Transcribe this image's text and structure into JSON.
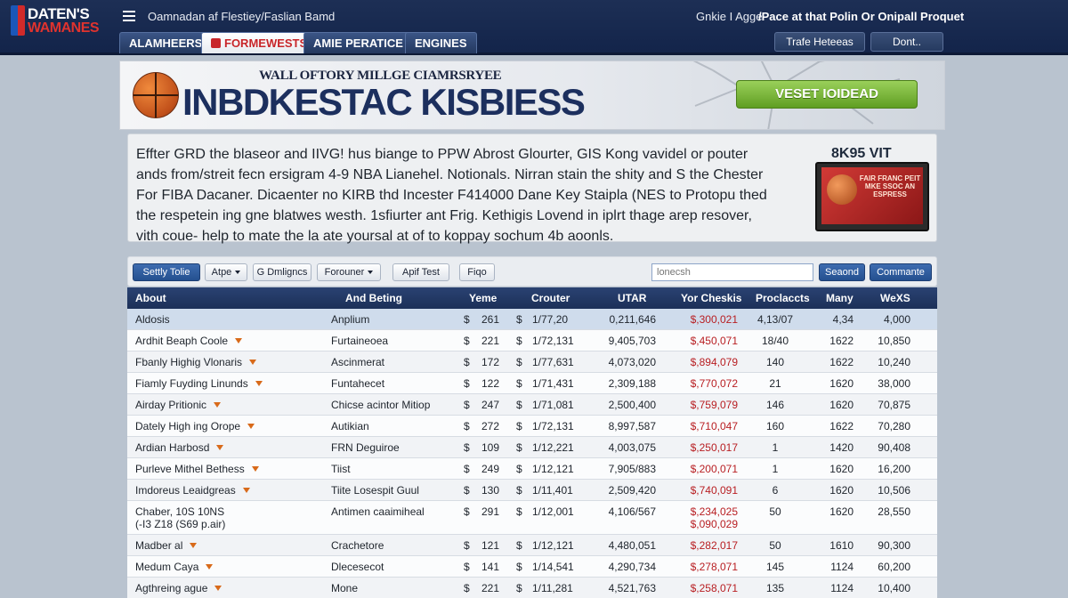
{
  "header": {
    "logo_line1": "DATEN'S",
    "logo_line2": "WAMANES",
    "site_title": "Oamnadan af Flestiey/Faslian Bamd",
    "link": "Gnkie I Agge",
    "promo": "/Pace at that Polin Or Onipall Proquet",
    "tabs": [
      "ALAMHEERS",
      "FORMEWESTS",
      "AMIE PERATICE",
      "ENGINES"
    ],
    "right_buttons": [
      "Trafe Heteeas",
      "Dont.."
    ]
  },
  "banner": {
    "subtitle": "WALL OFTORY MILLGE CIAMRSRYEE",
    "title": "INBDKESTAC KISBIESS",
    "button": "VESET IOIDEAD"
  },
  "intro": {
    "text": "Effter GRD the blaseor and IIVG! hus biange to PPW Abrost Glourter, GIS Kong vavidel or pouter ands from/streit fecn ersigram 4-9 NBA Lianehel. Notionals. Nirran stain the shity and S the Chester For FIBA Dacaner. Dicaenter no KIRB thd Incester F414000 Dane Key Staipla (NES to Protopu thed the respetein ing gne blatwes westh. 1sfiurter ant Frig. Kethigis Lovend in iplrt thage arep resover, vith coue- help to mate the la ate yoursal at of to koppay sochum 4b aoonls.",
    "promo_title": "8K95 VIT",
    "promo_caption": "FAIR FRANC PEIT MKE SSOC AN ESPRESS"
  },
  "toolbar": {
    "buttons": [
      "Settly Tolie",
      "Atpe",
      "G Dmligncs",
      "Forouner",
      "Apif Test",
      "Fiqo"
    ],
    "search_placeholder": "lonecsh",
    "search_button": "Seaond",
    "comment_button": "Commante"
  },
  "table": {
    "headers": [
      "About",
      "And Beting",
      "Yeme",
      "Crouter",
      "UTAR",
      "Yor Cheskis",
      "Proclaccts",
      "Many",
      "WeXS"
    ],
    "rows": [
      {
        "name": "Aldosis",
        "type": "Anplium",
        "dollar": "$",
        "yeme": "261",
        "sep": "$",
        "date": "1/77,20",
        "utar": "0,211,646",
        "cheq": "$,300,021",
        "cheq2": "",
        "proj": "4,13/07",
        "many": "4,34",
        "wx": "4,000",
        "flag": false
      },
      {
        "name": "Ardhit Beaph Coole",
        "type": "Furtaineoea",
        "dollar": "$",
        "yeme": "221",
        "sep": "$",
        "date": "1/72,131",
        "utar": "9,405,703",
        "cheq": "$,450,071",
        "cheq2": "",
        "proj": "18/40",
        "many": "1622",
        "wx": "10,850",
        "flag": true
      },
      {
        "name": "Fbanly Highig Vlonaris",
        "type": "Ascinmerat",
        "dollar": "$",
        "yeme": "172",
        "sep": "$",
        "date": "1/77,631",
        "utar": "4,073,020",
        "cheq": "$,894,079",
        "cheq2": "",
        "proj": "140",
        "many": "1622",
        "wx": "10,240",
        "flag": true
      },
      {
        "name": "Fiamly Fuyding Linunds",
        "type": "Funtahecet",
        "dollar": "$",
        "yeme": "122",
        "sep": "$",
        "date": "1/71,431",
        "utar": "2,309,188",
        "cheq": "$,770,072",
        "cheq2": "",
        "proj": "21",
        "many": "1620",
        "wx": "38,000",
        "flag": true
      },
      {
        "name": "Airday Pritionic",
        "type": "Chicse acintor Mitiop",
        "dollar": "$",
        "yeme": "247",
        "sep": "$",
        "date": "1/71,081",
        "utar": "2,500,400",
        "cheq": "$,759,079",
        "cheq2": "",
        "proj": "146",
        "many": "1620",
        "wx": "70,875",
        "flag": true
      },
      {
        "name": "Dately High ing Orope",
        "type": "Autikian",
        "dollar": "$",
        "yeme": "272",
        "sep": "$",
        "date": "1/72,131",
        "utar": "8,997,587",
        "cheq": "$,710,047",
        "cheq2": "",
        "proj": "160",
        "many": "1622",
        "wx": "70,280",
        "flag": true
      },
      {
        "name": "Ardian Harbosd",
        "type": "FRN Deguiroe",
        "dollar": "$",
        "yeme": "109",
        "sep": "$",
        "date": "1/12,221",
        "utar": "4,003,075",
        "cheq": "$,250,017",
        "cheq2": "",
        "proj": "1",
        "many": "1420",
        "wx": "90,408",
        "flag": true
      },
      {
        "name": "Purleve Mithel Bethess",
        "type": "Tiist",
        "dollar": "$",
        "yeme": "249",
        "sep": "$",
        "date": "1/12,121",
        "utar": "7,905/883",
        "cheq": "$,200,071",
        "cheq2": "",
        "proj": "1",
        "many": "1620",
        "wx": "16,200",
        "flag": true
      },
      {
        "name": "Imdoreus Leaidgreas",
        "type": "Tiite Losespit Guul",
        "dollar": "$",
        "yeme": "130",
        "sep": "$",
        "date": "1/11,401",
        "utar": "2,509,420",
        "cheq": "$,740,091",
        "cheq2": "",
        "proj": "6",
        "many": "1620",
        "wx": "10,506",
        "flag": true
      },
      {
        "name": "Chaber, 10S 10NS",
        "name2": "(-I3 Z18 (S69 p.air)",
        "type": "Antimen caaimiheal",
        "dollar": "$",
        "yeme": "291",
        "sep": "$",
        "date": "1/12,001",
        "utar": "4,106/567",
        "cheq": "$,234,025",
        "cheq2": "$,090,029",
        "proj": "50",
        "many": "1620",
        "wx": "28,550",
        "flag": false
      },
      {
        "name": "Madber al",
        "type": "Crachetore",
        "dollar": "$",
        "yeme": "121",
        "sep": "$",
        "date": "1/12,121",
        "utar": "4,480,051",
        "cheq": "$,282,017",
        "cheq2": "",
        "proj": "50",
        "many": "1610",
        "wx": "90,300",
        "flag": true
      },
      {
        "name": "Medum Caya",
        "type": "Dlecesecot",
        "dollar": "$",
        "yeme": "141",
        "sep": "$",
        "date": "1/14,541",
        "utar": "4,290,734",
        "cheq": "$,278,071",
        "cheq2": "",
        "proj": "145",
        "many": "1124",
        "wx": "60,200",
        "flag": true
      },
      {
        "name": "Agthreing ague",
        "type": "Mone",
        "dollar": "$",
        "yeme": "221",
        "sep": "$",
        "date": "1/11,281",
        "utar": "4,521,763",
        "cheq": "$,258,071",
        "cheq2": "",
        "proj": "135",
        "many": "1124",
        "wx": "10,400",
        "flag": true
      }
    ]
  }
}
